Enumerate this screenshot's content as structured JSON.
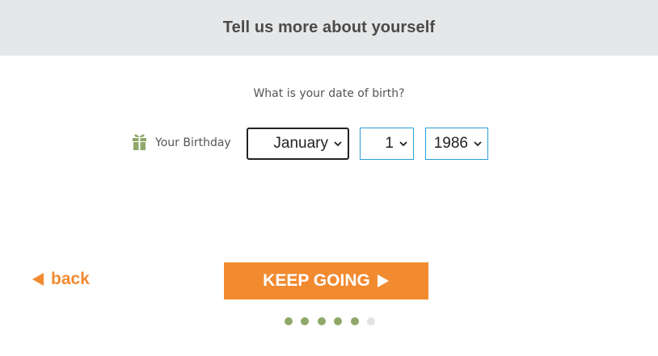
{
  "header": {
    "title": "Tell us more about yourself"
  },
  "question": "What is your date of birth?",
  "birthday": {
    "label": "Your Birthday",
    "month": "January",
    "day": "1",
    "year": "1986"
  },
  "actions": {
    "back_label": "back",
    "keep_going_label": "KEEP GOING"
  },
  "progress": {
    "total_steps": 6,
    "current_step": 5
  },
  "colors": {
    "accent": "#f28a30",
    "progress_done": "#8fa86a",
    "progress_todo": "#e2e2e2",
    "header_bg": "#e6e7e8",
    "select_focus_border": "#2a9fd6"
  },
  "icons": [
    "gift-icon",
    "chevron-down-icon",
    "triangle-left-icon",
    "triangle-right-icon"
  ]
}
